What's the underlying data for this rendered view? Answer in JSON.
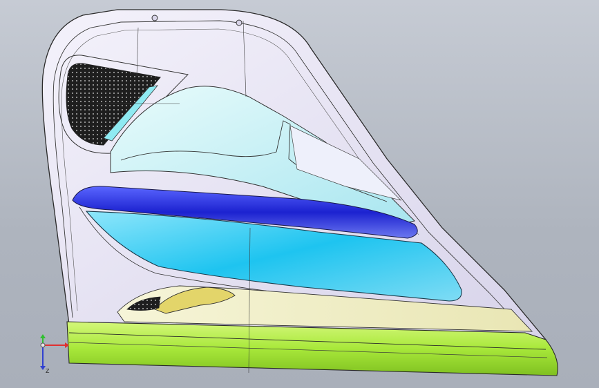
{
  "viewport": {
    "background_top": "#c6cbd4",
    "background_bottom": "#a9afba"
  },
  "model": {
    "part": "door-trim-panel",
    "colors": {
      "panel_face": "#e6e3f2",
      "panel_edge": "#c9c4de",
      "upper_window": "#bfeff4",
      "armrest_blue": "#2a2ee0",
      "pocket_cyan": "#22c8ee",
      "handle_area": "#efeec4",
      "handle_yellow": "#e6d96a",
      "lower_strip": "#b8f04a",
      "speaker_grille": "#2a2a2a"
    }
  },
  "triad": {
    "axes": [
      "x",
      "y",
      "z"
    ],
    "x_color": "#e03030",
    "y_color": "#30c030",
    "z_color": "#3040d0",
    "z_label": "Z"
  }
}
